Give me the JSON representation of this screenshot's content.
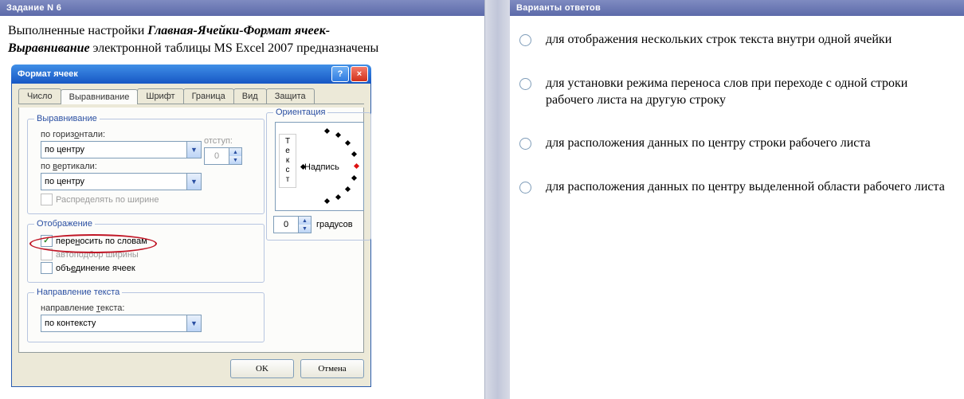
{
  "left": {
    "header": "Задание N 6",
    "q_line1_plain": "Выполненные настройки ",
    "q_line1_bold": "Главная-Ячейки-Формат ячеек-",
    "q_line2_bold": "Выравнивание",
    "q_line2_plain": " электронной таблицы MS Excel 2007 предназначены"
  },
  "dialog": {
    "title": "Формат ячеек",
    "help": "?",
    "close": "×",
    "tabs": [
      "Число",
      "Выравнивание",
      "Шрифт",
      "Граница",
      "Вид",
      "Защита"
    ],
    "group_align": "Выравнивание",
    "lbl_horiz": "по горизонтали:",
    "val_horiz": "по центру",
    "lbl_indent": "отступ:",
    "val_indent": "0",
    "lbl_vert": "по вертикали:",
    "val_vert": "по центру",
    "chk_distribute": "Распределять по ширине",
    "group_display": "Отображение",
    "chk_wrap": "переносить по словам",
    "chk_autofit": "автоподбор ширины",
    "chk_merge": "объединение ячеек",
    "group_dir": "Направление текста",
    "lbl_dir": "направление текста:",
    "val_dir": "по контексту",
    "group_orient": "Ориентация",
    "orient_vtext": "Текст",
    "orient_label": "Надпись",
    "val_deg": "0",
    "lbl_deg": "градусов",
    "btn_ok": "OK",
    "btn_cancel": "Отмена"
  },
  "right": {
    "header": "Варианты ответов",
    "answers": [
      "для отображения нескольких строк текста внутри одной ячейки",
      "для установки режима переноса слов при переходе с одной строки рабочего листа на другую строку",
      "для расположения данных по центру строки рабочего листа",
      "для расположения данных по центру выделенной области рабочего листа"
    ]
  }
}
